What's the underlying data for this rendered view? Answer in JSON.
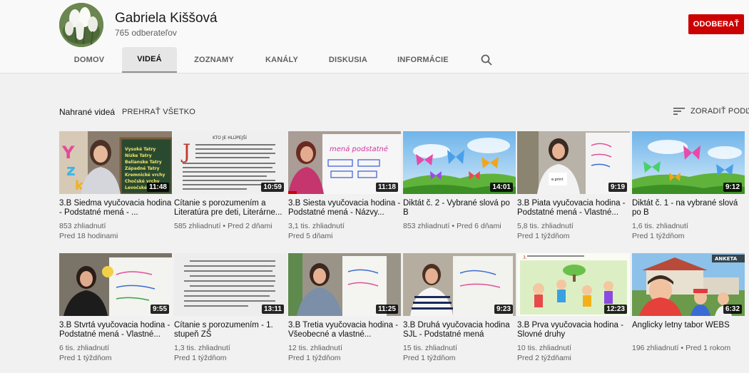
{
  "channel": {
    "name": "Gabriela Kiššová",
    "subscribers": "765 odberateľov",
    "subscribe_label": "ODOBERAŤ"
  },
  "tabs": [
    {
      "label": "DOMOV"
    },
    {
      "label": "VIDEÁ"
    },
    {
      "label": "ZOZNAMY"
    },
    {
      "label": "KANÁLY"
    },
    {
      "label": "DISKUSIA"
    },
    {
      "label": "INFORMÁCIE"
    }
  ],
  "section": {
    "title": "Nahrané videá",
    "play_all": "PREHRAŤ VŠETKO",
    "sort": "ZORADIŤ PODĽA"
  },
  "videos": [
    {
      "title": "3.B Siedma vyučovacia hodina - Podstatné mená - ...",
      "views": "853 zhliadnutí",
      "age": "Pred 18 hodinami",
      "duration": "11:48",
      "meta_inline": false
    },
    {
      "title": "Čítanie s porozumením a Literatúra pre deti, Literárne...",
      "views": "585 zhliadnutí",
      "age": "Pred 2 dňami",
      "duration": "10:59",
      "meta_inline": true
    },
    {
      "title": "3.B Siesta vyučovacia hodina - Podstatné mená - Názvy...",
      "views": "3,1 tis. zhliadnutí",
      "age": "Pred 5 dňami",
      "duration": "11:18",
      "meta_inline": false
    },
    {
      "title": "Diktát č. 2 - Vybrané slová po B",
      "views": "853 zhliadnutí",
      "age": "Pred 6 dňami",
      "duration": "14:01",
      "meta_inline": true
    },
    {
      "title": "3.B Piata vyučovacia hodina - Podstatné mená - Vlastné...",
      "views": "5,8 tis. zhliadnutí",
      "age": "Pred 1 týždňom",
      "duration": "9:19",
      "meta_inline": false
    },
    {
      "title": "Diktát č. 1 - na vybrané slová po B",
      "views": "1,6 tis. zhliadnutí",
      "age": "Pred 1 týždňom",
      "duration": "9:12",
      "meta_inline": false
    },
    {
      "title": "3.B Štvrtá vyučovacia hodina - Podstatné mená - Vlastné...",
      "views": "6 tis. zhliadnutí",
      "age": "Pred 1 týždňom",
      "duration": "9:55",
      "meta_inline": false
    },
    {
      "title": "Čítanie s porozumením - 1. stupeň ZŠ",
      "views": "1,3 tis. zhliadnutí",
      "age": "Pred 1 týždňom",
      "duration": "13:11",
      "meta_inline": false
    },
    {
      "title": "3.B Tretia vyučovacia hodina - Všeobecné a vlastné...",
      "views": "12 tis. zhliadnutí",
      "age": "Pred 1 týždňom",
      "duration": "11:25",
      "meta_inline": false
    },
    {
      "title": "3.B Druhá vyučovacia hodina SJL - Podstatné mená",
      "views": "15 tis. zhliadnutí",
      "age": "Pred 1 týždňom",
      "duration": "9:23",
      "meta_inline": false
    },
    {
      "title": "3.B Prva vyučovacia hodina - Slovné druhy",
      "views": "10 tis. zhliadnutí",
      "age": "Pred 2 týždňami",
      "duration": "12:23",
      "meta_inline": false
    },
    {
      "title": "Anglicky letny tabor WEBS",
      "views": "196 zhliadnutí",
      "age": "Pred 1 rokom",
      "duration": "6:32",
      "meta_inline": true
    }
  ],
  "thumb_texts": {
    "board_lines": [
      "Vysoké Tatry",
      "Nízke Tatry",
      "Belianske Tatry",
      "Západné Tatry",
      "Kremnické vrchy",
      "Chočské vrchy",
      "Levočské vrchy"
    ],
    "book_heading": "KTO JE HLÚPEJŠÍ",
    "flip_text": "mená podstatné",
    "anketa": "ANKETA"
  },
  "colors": {
    "subscribe": "#cc0000",
    "background": "#f1f1f1",
    "header": "#f9f9f9"
  }
}
